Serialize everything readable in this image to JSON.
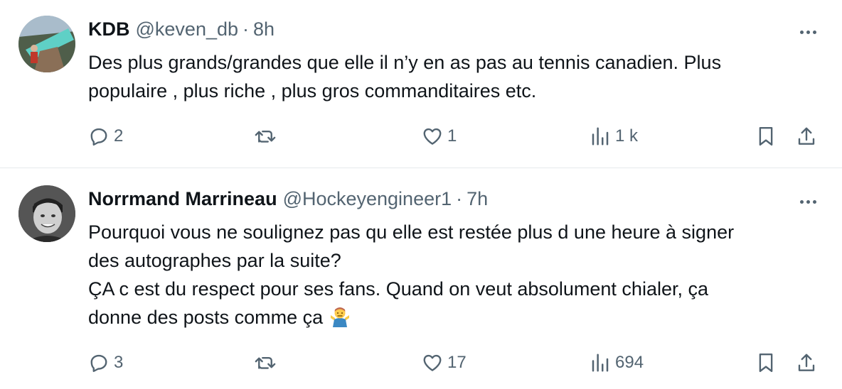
{
  "colors": {
    "text": "#0f1419",
    "muted": "#536471",
    "divider": "#e6e9ec"
  },
  "tweets": [
    {
      "name": "KDB",
      "handle": "@keven_db",
      "separator": "·",
      "time": "8h",
      "text": "Des plus grands/grandes que elle il n’y en as pas au tennis canadien. Plus\npopulaire , plus riche , plus gros commanditaires etc.",
      "replies": "2",
      "retweets": "",
      "likes": "1",
      "views": "1 k"
    },
    {
      "name": "Norrmand Marrineau",
      "handle": "@Hockeyengineer1",
      "separator": "·",
      "time": "7h",
      "text": "Pourquoi vous ne soulignez pas qu elle est restée plus d une heure à signer\ndes autographes par la suite?\nÇA c est du respect pour ses fans. Quand on veut absolument chialer, ça\ndonne des posts comme ça",
      "emoji": "man-shrugging-icon",
      "replies": "3",
      "retweets": "",
      "likes": "17",
      "views": "694"
    }
  ]
}
